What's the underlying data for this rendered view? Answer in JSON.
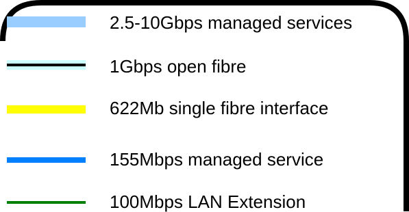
{
  "legend": {
    "items": [
      {
        "label": "2.5-10Gbps managed services",
        "style": "light-blue-band",
        "color": "#99ccff"
      },
      {
        "label": "1Gbps open fibre",
        "style": "black-line-with-light-cyan-bands",
        "color": "#000000",
        "band_color": "#ccffff"
      },
      {
        "label": "622Mb single fibre interface",
        "style": "yellow-band",
        "color": "#ffff00"
      },
      {
        "label": "155Mbps managed service",
        "style": "blue-band",
        "color": "#0080ff"
      },
      {
        "label": "100Mbps LAN Extension",
        "style": "green-line",
        "color": "#008000"
      }
    ]
  }
}
